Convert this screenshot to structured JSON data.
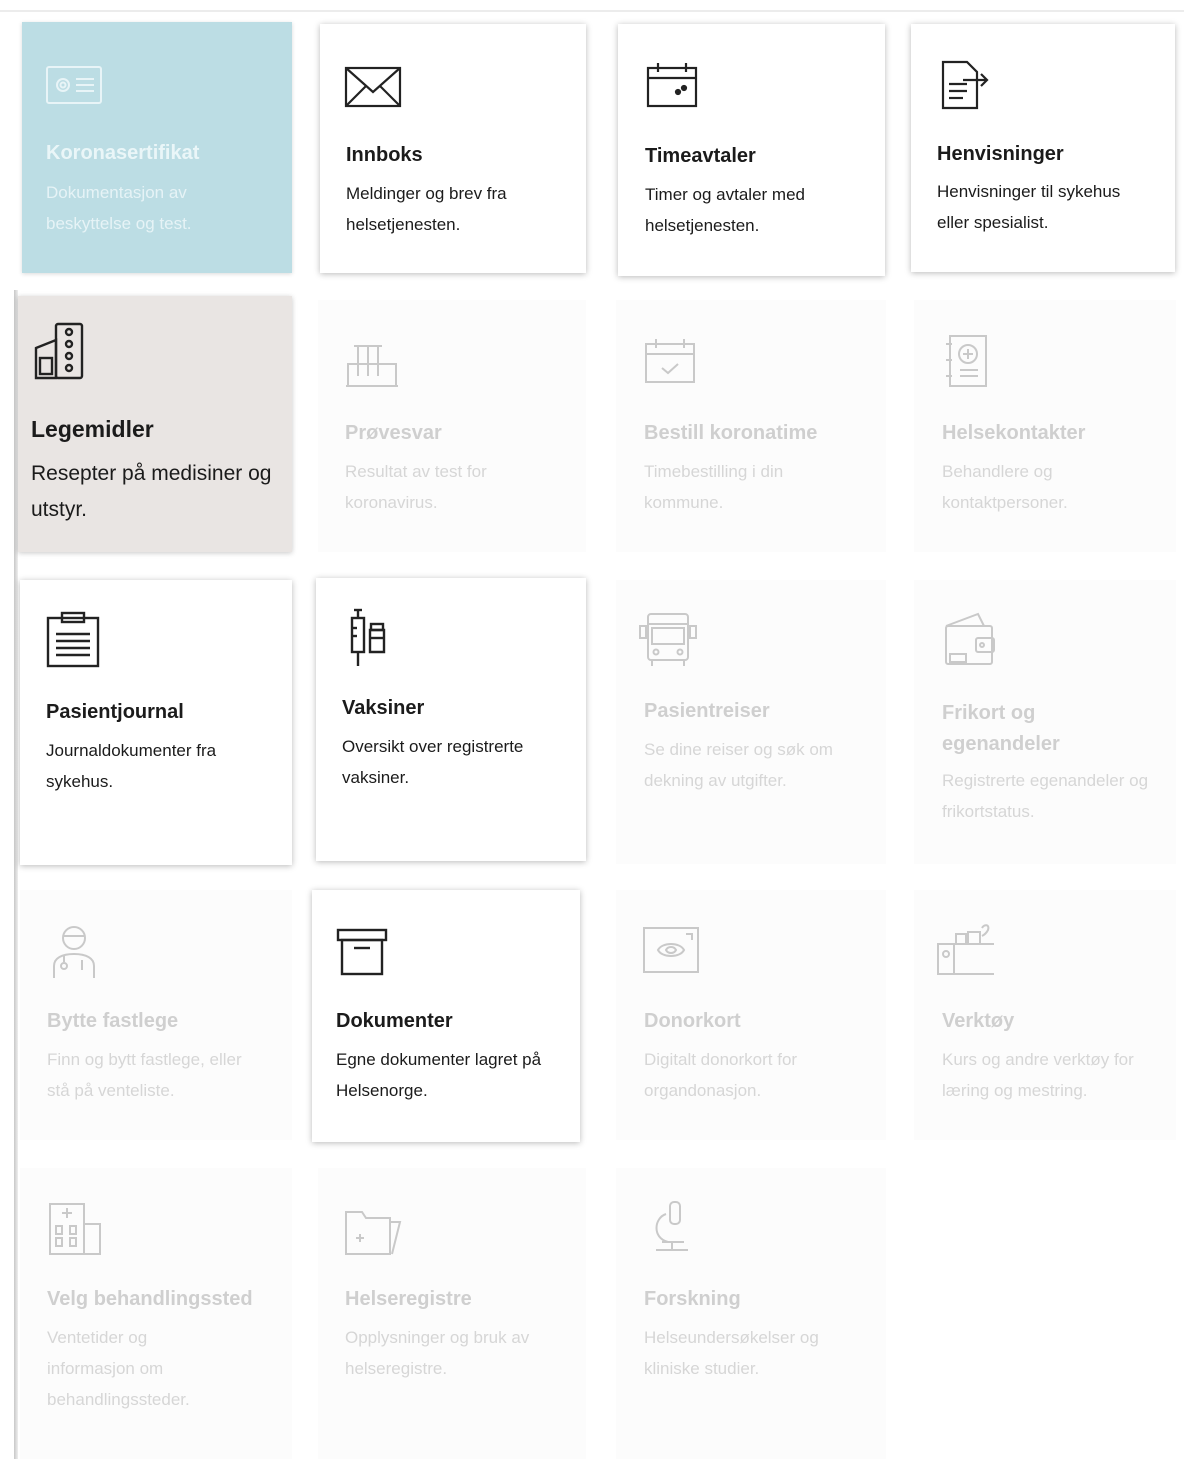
{
  "tiles": [
    {
      "title": "Koronasertifikat",
      "description": "Dokumentasjon av beskyttelse og test."
    },
    {
      "title": "Innboks",
      "description": "Meldinger og brev fra helsetjenesten."
    },
    {
      "title": "Timeavtaler",
      "description": "Timer og avtaler med helsetjenesten."
    },
    {
      "title": "Henvisninger",
      "description": "Henvisninger til sykehus eller spesialist."
    },
    {
      "title": "Legemidler",
      "description": "Resepter på medisiner og utstyr."
    },
    {
      "title": "Prøvesvar",
      "description": "Resultat av test for koronavirus."
    },
    {
      "title": "Bestill koronatime",
      "description": "Timebestilling i din kommune."
    },
    {
      "title": "Helsekontakter",
      "description": "Behandlere og kontaktpersoner."
    },
    {
      "title": "Pasientjournal",
      "description": "Journaldokumenter fra sykehus."
    },
    {
      "title": "Vaksiner",
      "description": "Oversikt over registrerte vaksiner."
    },
    {
      "title": "Pasientreiser",
      "description": "Se dine reiser og søk om dekning av utgifter."
    },
    {
      "title": "Frikort og egenandeler",
      "description": "Registrerte egenandeler og frikortstatus."
    },
    {
      "title": "Bytte fastlege",
      "description": "Finn og bytt fastlege, eller stå på venteliste."
    },
    {
      "title": "Dokumenter",
      "description": "Egne dokumenter lagret på Helsenorge."
    },
    {
      "title": "Donorkort",
      "description": "Digitalt donorkort for organdonasjon."
    },
    {
      "title": "Verktøy",
      "description": "Kurs og andre verktøy for læring og mestring."
    },
    {
      "title": "Velg behandlingssted",
      "description": "Ventetider og informasjon om behandlingssteder."
    },
    {
      "title": "Helseregistre",
      "description": "Opplysninger og bruk av helseregistre."
    },
    {
      "title": "Forskning",
      "description": "Helseundersøkelser og kliniske studier."
    }
  ],
  "icons": [
    "id-card-icon",
    "envelope-icon",
    "calendar-icon",
    "referral-document-icon",
    "medicine-icon",
    "test-tubes-icon",
    "calendar-check-icon",
    "contact-book-icon",
    "clipboard-icon",
    "syringe-vial-icon",
    "bus-icon",
    "wallet-icon",
    "doctor-icon",
    "archive-box-icon",
    "donor-card-icon",
    "toolbox-icon",
    "hospital-icon",
    "folder-icon",
    "microscope-icon"
  ],
  "colors": {
    "highlight_tile": "#bcdde4",
    "selected_tile": "#e9e5e3",
    "active_text": "#1b1b1b",
    "inactive_text": "#cfcfcf"
  }
}
